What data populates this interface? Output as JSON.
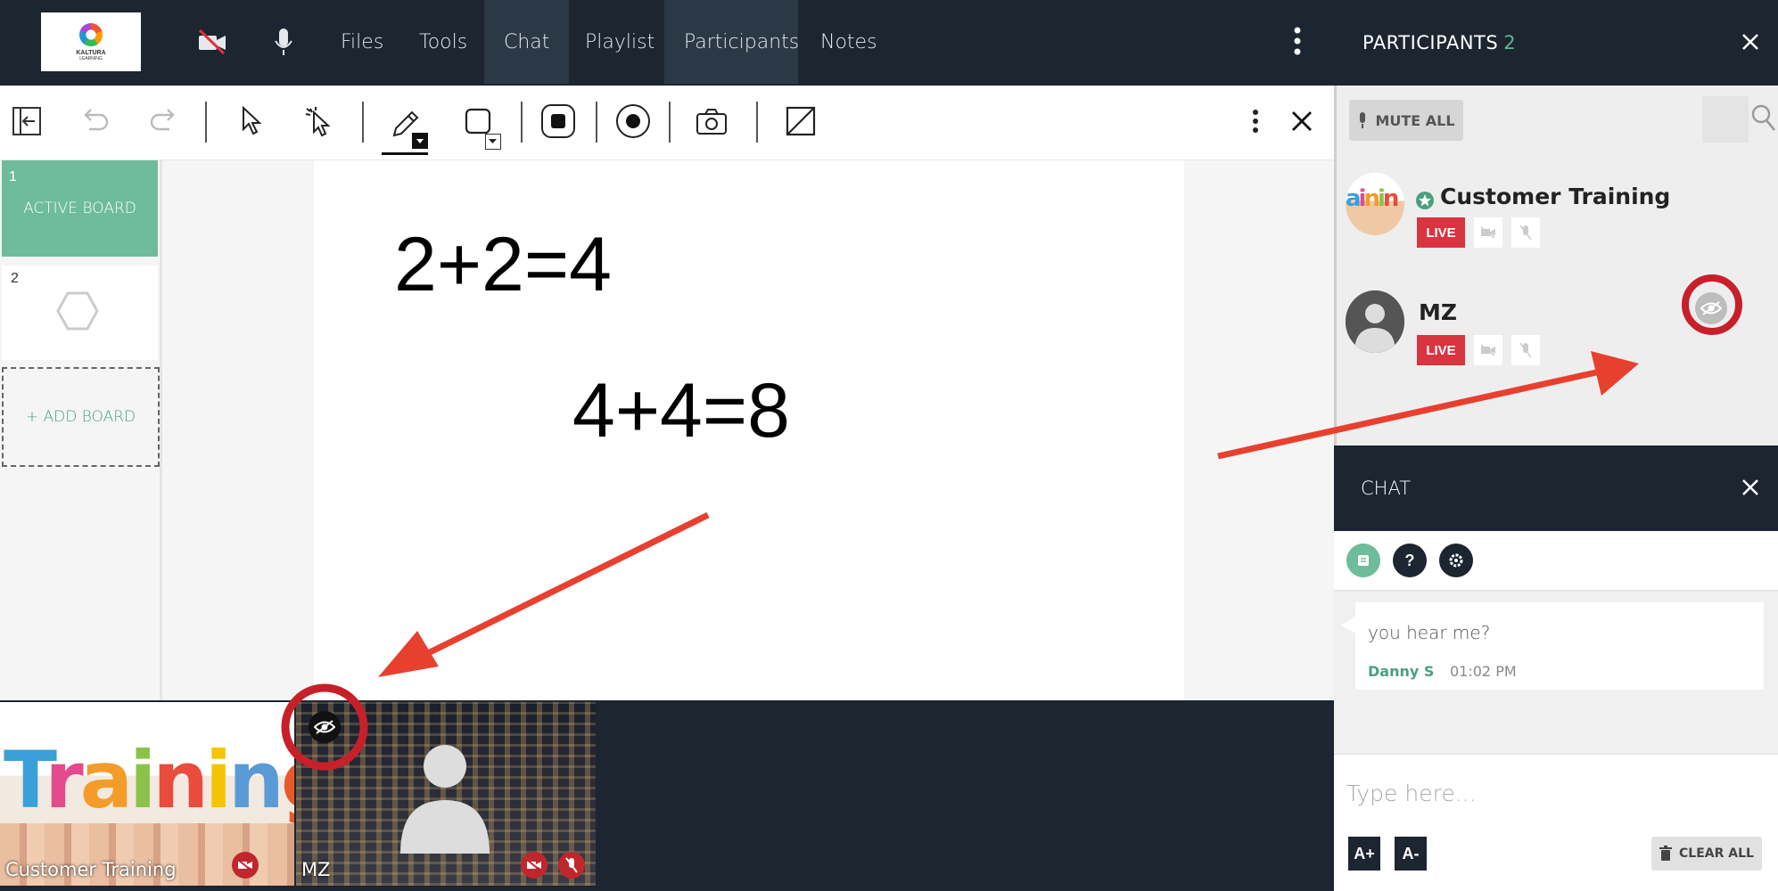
{
  "topbar": {
    "logo_text": "KALTURA",
    "logo_subtext": "LEARNING",
    "nav": [
      {
        "label": "Files",
        "active": false
      },
      {
        "label": "Tools",
        "active": false
      },
      {
        "label": "Chat",
        "active": true
      },
      {
        "label": "Playlist",
        "active": false
      },
      {
        "label": "Participants",
        "active": true
      },
      {
        "label": "Notes",
        "active": false
      }
    ],
    "icons": [
      "camera-off-icon",
      "microphone-icon",
      "more-vertical-icon"
    ]
  },
  "participants_panel": {
    "title": "PARTICIPANTS",
    "count": "2",
    "mute_all_label": "MUTE ALL",
    "people": [
      {
        "name": "Customer Training",
        "badge": "LIVE",
        "is_host": true
      },
      {
        "name": "MZ",
        "badge": "LIVE",
        "is_host": false
      }
    ]
  },
  "toolbar": {
    "tools": [
      "collapse-sidebar-icon",
      "undo-icon",
      "redo-icon",
      "select-pointer-icon",
      "laser-pointer-icon",
      "pencil-icon",
      "shape-square-icon",
      "stop-record-icon",
      "record-icon",
      "camera-icon",
      "clear-board-icon",
      "more-vertical-icon",
      "close-icon"
    ]
  },
  "boards": {
    "items": [
      {
        "number": "1",
        "label": "ACTIVE BOARD"
      },
      {
        "number": "2",
        "label": ""
      }
    ],
    "add_label": "+ ADD BOARD"
  },
  "whiteboard": {
    "line1": "2+2=4",
    "line2": "4+4=8"
  },
  "stage": {
    "tiles": [
      {
        "name": "Customer Training",
        "image_word": "Training"
      },
      {
        "name": "MZ"
      }
    ]
  },
  "chat": {
    "title": "CHAT",
    "messages": [
      {
        "text": "you hear me?",
        "author": "Danny S",
        "time": "01:02 PM"
      }
    ],
    "input_placeholder": "Type here...",
    "font_increase": "A+",
    "font_decrease": "A-",
    "clear_all_label": "CLEAR ALL"
  },
  "colors": {
    "dark_bar": "#1c2530",
    "accent_green": "#6ebc9c",
    "live_red": "#d93440",
    "annotation_red": "#e8402f"
  }
}
